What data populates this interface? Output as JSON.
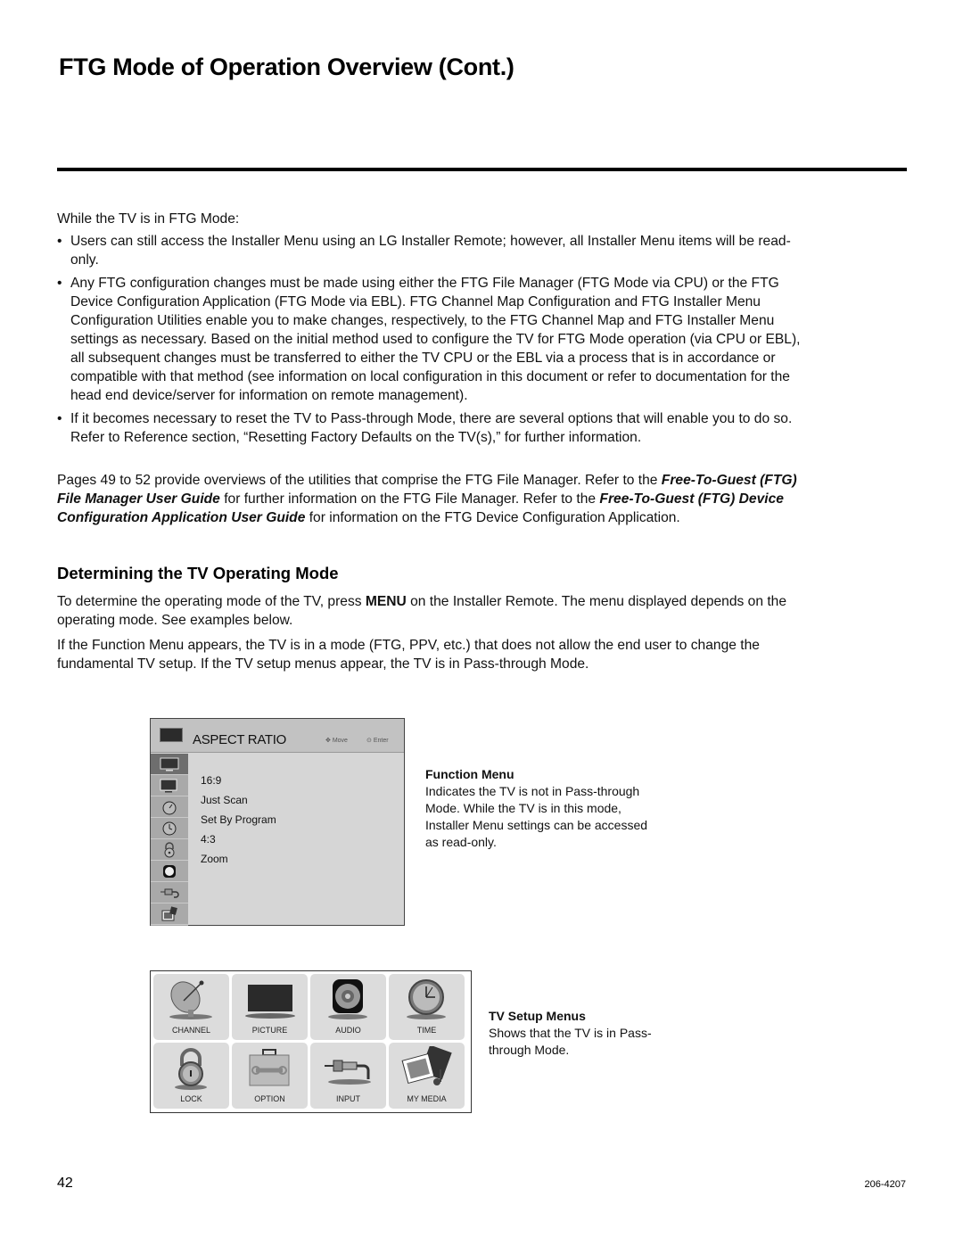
{
  "page": {
    "title": "FTG Mode of Operation Overview (Cont.)",
    "page_number": "42",
    "doc_number": "206-4207"
  },
  "intro": "While the TV is in FTG Mode:",
  "bullets": [
    "Users can still access the Installer Menu using an LG Installer Remote; however, all Installer Menu items will be read-only.",
    "Any FTG configuration changes must be made using either the FTG File Manager (FTG Mode via CPU) or the FTG Device Configuration Application (FTG Mode via EBL). FTG Channel Map Configuration and FTG Installer Menu Configuration Utilities enable you to make changes, respectively, to the FTG Channel Map and FTG Installer Menu settings as necessary. Based on the initial method used to configure the TV for FTG Mode operation (via CPU or EBL), all subsequent changes must be transferred to either the TV CPU or the EBL via a process that is in accordance or compatible with that method (see information on local configuration in this document or refer to documentation for the head end device/server for information on remote management).",
    "If it becomes necessary to reset the TV to Pass-through Mode, there are several options that will enable you to do so. Refer to Reference section, “Resetting Factory Defaults on the TV(s),” for further information."
  ],
  "pages_para": {
    "part1": "Pages 49 to 52 provide overviews of the utilities that comprise the FTG File Manager. Refer to the ",
    "guide1": "Free-To-Guest (FTG) File Manager User Guide",
    "part2": " for further information on the FTG File Manager. Refer to the ",
    "guide2": "Free-To-Guest (FTG) Device Configuration Application User Guide",
    "part3": " for information on the FTG Device Configuration Application."
  },
  "section": {
    "heading": "Determining the TV Operating Mode",
    "para1_a": "To determine the operating mode of the TV, press ",
    "para1_key": "MENU",
    "para1_b": " on the Installer Remote. The menu displayed depends on the operating mode. See examples below.",
    "para2": "If the Function Menu appears, the TV is in a mode (FTG, PPV, etc.) that does not allow the end user to change the fundamental TV setup. If the TV setup menus appear, the TV is in Pass-through Mode."
  },
  "function_menu": {
    "title": "ASPECT RATIO",
    "move_label": "Move",
    "enter_label": "Enter",
    "options": [
      "16:9",
      "Just Scan",
      "Set By Program",
      "4:3",
      "Zoom"
    ],
    "side_icons": [
      "tv-icon",
      "tv-small-icon",
      "timer-icon",
      "clock-icon",
      "lock-icon",
      "dark-circle-icon",
      "plug-icon",
      "media-icon"
    ],
    "caption_title": "Function Menu",
    "caption_text": "Indicates the TV is not in Pass-through Mode. While the TV is in this mode, Installer Menu settings can be accessed as read-only."
  },
  "setup_menus": {
    "tiles": [
      {
        "label": "CHANNEL",
        "icon": "satellite-dish-icon"
      },
      {
        "label": "PICTURE",
        "icon": "tv-icon"
      },
      {
        "label": "AUDIO",
        "icon": "speaker-icon"
      },
      {
        "label": "TIME",
        "icon": "clock-icon"
      },
      {
        "label": "LOCK",
        "icon": "padlock-icon"
      },
      {
        "label": "OPTION",
        "icon": "toolbox-icon"
      },
      {
        "label": "INPUT",
        "icon": "rca-plug-icon"
      },
      {
        "label": "MY MEDIA",
        "icon": "photo-music-icon"
      }
    ],
    "caption_title": "TV Setup Menus",
    "caption_text": "Shows that the TV is in Pass-through Mode."
  }
}
